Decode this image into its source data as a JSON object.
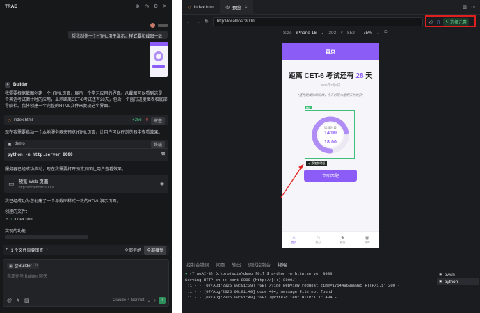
{
  "left": {
    "brand": "TRAE",
    "user_message": "帮我制作一个HTML用于演示，样式要和截图一致",
    "agent_label": "Builder",
    "para1": "我需要根据截图创建一个HTML页面，展示一个学习应用的界面。从截图可以看到这是一个英语考试倒计时的应用，显示距离CET-6考试还有28天，包含一个圆形进度图表和底部导航栏。我将创建一个完整的HTML文件来复现这个界面。",
    "file_card": {
      "name": "index.html",
      "added": "+256",
      "removed": "-0",
      "action": "审查"
    },
    "para2": "现在我需要启动一个本地服务器来预览HTML页面，让用户可以在浏览器中查看效果。",
    "term_card": {
      "name": "demo",
      "action": "终端",
      "command": "python -m http.server 8000"
    },
    "para3": "服务器已经成功启动，现在我需要打开预览页面让用户查看效果。",
    "preview_card": {
      "title": "预览 Web 页面",
      "url": "http://localhost:8000/"
    },
    "para4": "我已经成功为您创建了一个与截图样式一致的HTML演示页面。",
    "files_label": "创建的文件：",
    "file_item": "index.html",
    "features_label": "实现的功能：",
    "pending": {
      "text": "1 个文件需要审查",
      "reject": "全部拒绝",
      "accept": "全部接受"
    },
    "input": {
      "mention": "@Builder",
      "placeholder": "你正在与 Builder 聊天",
      "model": "Claude-4-Sonnet"
    }
  },
  "right": {
    "tabs": [
      {
        "label": "index.html"
      },
      {
        "label": "预览"
      }
    ],
    "url": "http://localhost:8000/",
    "size_label": "Size",
    "device": "iPhone 16",
    "width": "393",
    "height": "852",
    "zoom": "75%",
    "select_element": "选择元素",
    "phone": {
      "header": "首页",
      "countdown_prefix": "距离 CET-6 考试还有 ",
      "countdown_days": "28",
      "countdown_suffix": " 天",
      "date": "2025年7月8日",
      "quote": "\"坚持是成功的阶梯，今天的努力是明天的收获\"",
      "tag": "tag",
      "chart_title": "选择时段",
      "time_start": "14:00",
      "time_sep": "-",
      "time_end": "18:00",
      "add_hint": "添加新时段",
      "button": "立即匹配",
      "nav": [
        {
          "label": "首页"
        },
        {
          "label": "组队"
        },
        {
          "label": "积分"
        },
        {
          "label": "我的"
        }
      ]
    },
    "panel_tabs": [
      {
        "label": "控制台错误"
      },
      {
        "label": "问题"
      },
      {
        "label": "输出"
      },
      {
        "label": "调试控制台"
      },
      {
        "label": "终端"
      }
    ],
    "terminal_lines": [
      "(TraeAI-3) D:\\projects\\demo [0:] $ python -m http.server 8000",
      "Serving HTTP on :: port 8000 (http://[::]:8000/) ...",
      "::1 - - [07/Aug/2025 00:01:39] \"GET /?ide_webview_request_time=1754496099995 HTTP/1.1\" 200 -",
      "::1 - - [07/Aug/2025 00:01:40] code 404, message File not found",
      "::1 - - [07/Aug/2025 00:01:40] \"GET /@vite/client HTTP/1.1\" 404 -"
    ],
    "shells": [
      {
        "label": "pwsh"
      },
      {
        "label": "python"
      }
    ]
  },
  "colors": {
    "accent": "#8b5cf6",
    "green": "#3fbf7a",
    "highlight": "#e0201c",
    "progress": "#b08cf5"
  },
  "chart_data": {
    "type": "pie",
    "values": [
      0.72
    ],
    "title": "选择时段"
  }
}
